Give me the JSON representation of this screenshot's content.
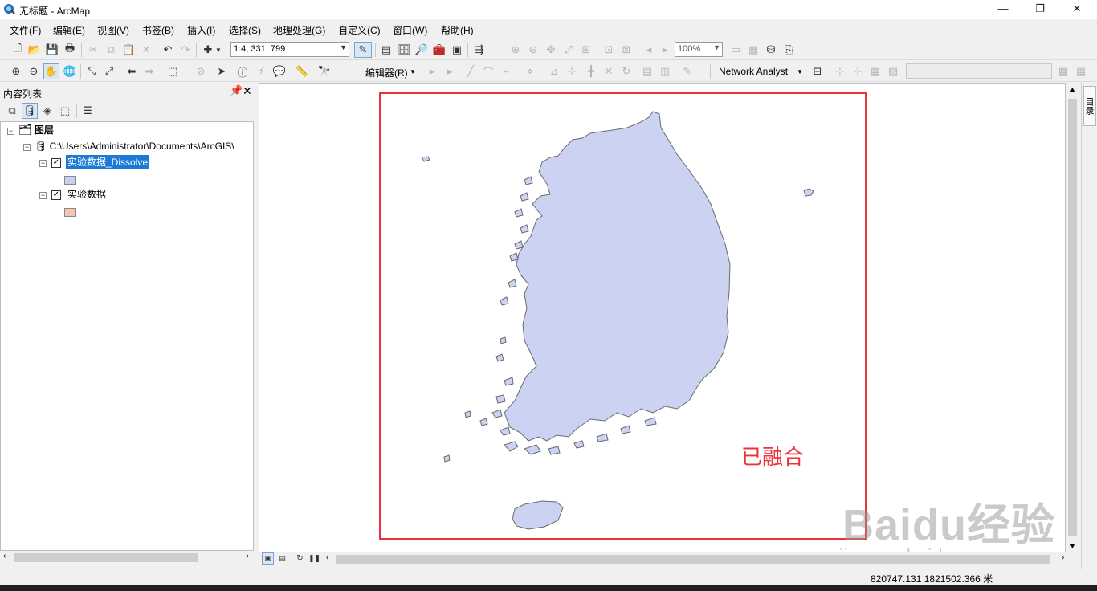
{
  "window": {
    "title": "无标题 - ArcMap",
    "minimize": "—",
    "restore": "❐",
    "close": "✕"
  },
  "menu": [
    "文件(F)",
    "编辑(E)",
    "视图(V)",
    "书签(B)",
    "插入(I)",
    "选择(S)",
    "地理处理(G)",
    "自定义(C)",
    "窗口(W)",
    "帮助(H)"
  ],
  "toolbar": {
    "scale": "1:4, 331, 799",
    "zoom_percent": "100%",
    "editor_label": "编辑器(R)",
    "network_analyst_label": "Network Analyst"
  },
  "toc": {
    "title": "内容列表",
    "root_label": "图层",
    "datasource_path": "C:\\Users\\Administrator\\Documents\\ArcGIS\\",
    "layers": [
      {
        "name": "实验数据_Dissolve",
        "checked": true,
        "selected": true,
        "swatch_color": "#c8cdf2"
      },
      {
        "name": "实验数据",
        "checked": true,
        "selected": false,
        "swatch_color": "#f5c4b2"
      }
    ]
  },
  "map": {
    "annotation_text": "已融合",
    "annotation_color": "#e8343a",
    "land_fill": "#ccd2f2",
    "land_stroke": "#6a6a6a"
  },
  "right_dock": {
    "tab_label": "目录"
  },
  "status": {
    "coordinates": "820747.131  1821502.366 米"
  },
  "watermark": {
    "brand": "Baidu经验",
    "url": "jingyan.baidu.com"
  }
}
